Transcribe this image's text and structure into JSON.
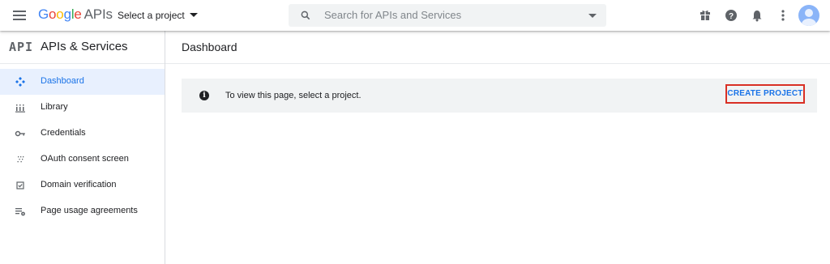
{
  "header": {
    "logo": {
      "g1": "G",
      "g2": "o",
      "g3": "o",
      "g4": "g",
      "g5": "l",
      "g6": "e",
      "apis": "APIs"
    },
    "project_select_label": "Select a project",
    "search_placeholder": "Search for APIs and Services",
    "icons": [
      "menu-icon",
      "search-icon",
      "dropdown-caret-icon",
      "gift-icon",
      "help-icon",
      "notifications-icon",
      "more-vert-icon",
      "account-avatar"
    ]
  },
  "sidebar": {
    "logo_text": "API",
    "title": "APIs & Services",
    "items": [
      {
        "label": "Dashboard",
        "icon": "dashboard-icon",
        "active": true
      },
      {
        "label": "Library",
        "icon": "library-icon",
        "active": false
      },
      {
        "label": "Credentials",
        "icon": "key-icon",
        "active": false
      },
      {
        "label": "OAuth consent screen",
        "icon": "oauth-icon",
        "active": false
      },
      {
        "label": "Domain verification",
        "icon": "checkbox-icon",
        "active": false
      },
      {
        "label": "Page usage agreements",
        "icon": "settings-list-icon",
        "active": false
      }
    ]
  },
  "main": {
    "title": "Dashboard",
    "banner_text": "To view this page, select a project.",
    "create_button": "CREATE PROJECT"
  },
  "colors": {
    "accent": "#1a73e8",
    "active_bg": "#e8f0fe",
    "highlight_border": "#d93025",
    "banner_bg": "#f1f3f4"
  }
}
